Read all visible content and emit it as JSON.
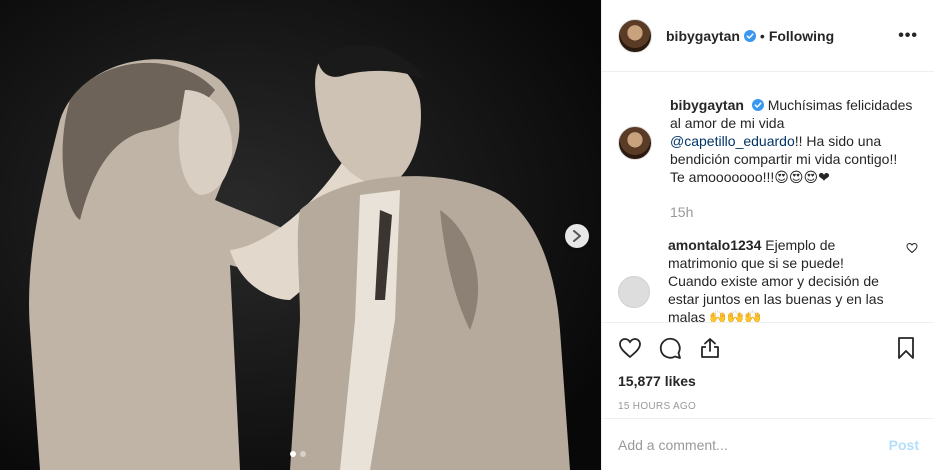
{
  "post": {
    "username": "bibygaytan",
    "separator": "•",
    "follow_status": "Following",
    "more_label": "•••",
    "photo_alt": "Black and white stage photo of a woman holding a man's face",
    "carousel": {
      "next_icon": "chevron-right-icon",
      "dots": 2,
      "active_dot": 0
    }
  },
  "caption": {
    "username": "bibygaytan",
    "text_start": "Muchísimas felicidades al amor de mi vida",
    "mention": "@capetillo_eduardo",
    "text_end": "!! Ha sido una bendición compartir mi vida contigo!! Te amooooooo!!!😍😍😍❤",
    "time": "15h"
  },
  "comment": {
    "username": "amontalo1234",
    "text": "Ejemplo de matrimonio que si se puede! Cuando existe amor y decisión de estar juntos en las buenas y en las malas 🙌🙌🙌"
  },
  "stats": {
    "likes": "15,877 likes",
    "posted": "15 HOURS AGO"
  },
  "compose": {
    "placeholder": "Add a comment...",
    "post_label": "Post"
  },
  "colors": {
    "verified": "#3897f0",
    "mention": "#003569",
    "post_disabled": "#b2dffc"
  }
}
